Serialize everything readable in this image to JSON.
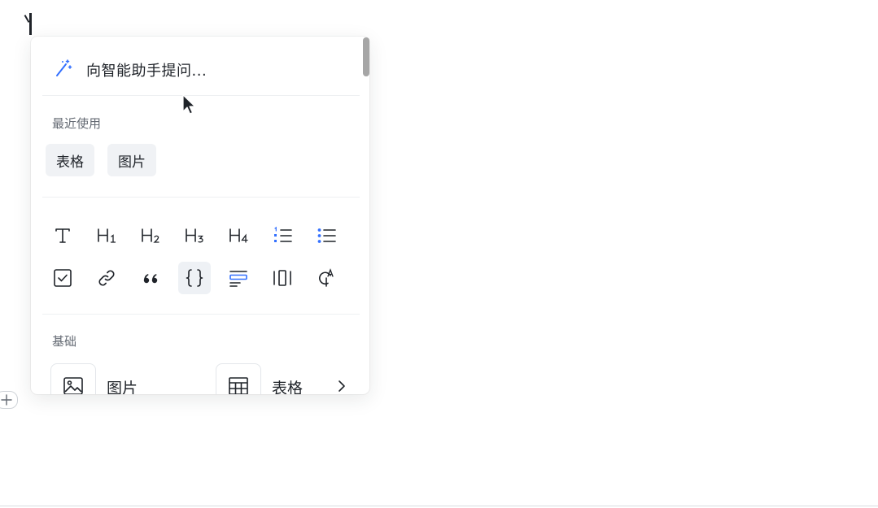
{
  "ai_prompt": {
    "label": "向智能助手提问..."
  },
  "recent": {
    "title": "最近使用",
    "items": [
      "表格",
      "图片"
    ]
  },
  "quick_blocks": [
    "text-icon",
    "heading-1-icon",
    "heading-2-icon",
    "heading-3-icon",
    "heading-4-icon",
    "ordered-list-icon",
    "bullet-list-icon",
    "checkbox-icon",
    "link-icon",
    "quote-icon",
    "code-block-icon",
    "callout-icon",
    "columns-icon",
    "mention-icon"
  ],
  "basic": {
    "title": "基础",
    "items": [
      {
        "label": "图片",
        "icon": "image-icon"
      },
      {
        "label": "表格",
        "icon": "table-icon"
      }
    ]
  },
  "colors": {
    "accent_blue": "#3370ff",
    "icon_dark": "#1f2329",
    "muted_text": "#646a73",
    "chip_bg": "#f0f2f5"
  }
}
